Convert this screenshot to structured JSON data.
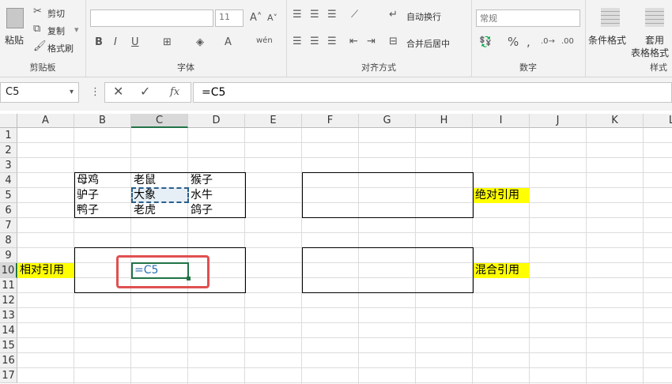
{
  "ribbon": {
    "clipboard": {
      "paste": "粘贴",
      "cut": "剪切",
      "copy": "复制",
      "format_painter": "格式刷",
      "group": "剪贴板"
    },
    "font": {
      "font_size": "11",
      "group": "字体"
    },
    "alignment": {
      "wrap": "自动换行",
      "merge": "合并后居中",
      "group": "对齐方式"
    },
    "number": {
      "format": "常规",
      "group": "数字"
    },
    "styles": {
      "conditional": "条件格式",
      "table1": "套用",
      "table2": "表格格式",
      "group": "样式"
    }
  },
  "formula_bar": {
    "name_box": "C5",
    "formula": "=C5"
  },
  "columns": [
    "A",
    "B",
    "C",
    "D",
    "E",
    "F",
    "G",
    "H",
    "I",
    "J",
    "K",
    "L"
  ],
  "rows": [
    "1",
    "2",
    "3",
    "4",
    "5",
    "6",
    "7",
    "8",
    "9",
    "10",
    "11",
    "12",
    "13",
    "14",
    "15",
    "16",
    "17"
  ],
  "cells": {
    "B4": "母鸡",
    "C4": "老鼠",
    "D4": "猴子",
    "B5": "驴子",
    "C5": "大象",
    "D5": "水牛",
    "B6": "鸭子",
    "C6": "老虎",
    "D6": "鸽子",
    "A10": "相对引用",
    "C10": "=C5",
    "I5": "绝对引用",
    "I10": "混合引用"
  },
  "colors": {
    "highlight": "#ffff00",
    "selection": "#217346",
    "annotation": "#e05050"
  }
}
